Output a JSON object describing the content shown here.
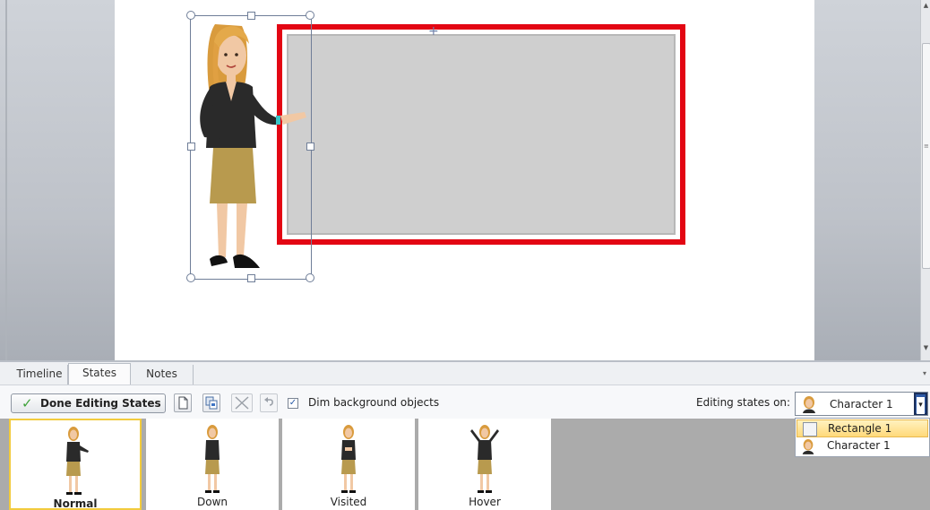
{
  "panel_tabs": [
    "Timeline",
    "States",
    "Notes"
  ],
  "toolbar": {
    "done_label": "Done Editing States",
    "dim_label": "Dim background objects",
    "dim_checked": true,
    "editing_on_label": "Editing states on:",
    "editing_on_value": "Character 1"
  },
  "dropdown": {
    "options": [
      "Rectangle 1",
      "Character 1"
    ],
    "highlighted": "Rectangle 1"
  },
  "states": [
    {
      "label": "Normal",
      "active": true
    },
    {
      "label": "Down",
      "active": false
    },
    {
      "label": "Visited",
      "active": false
    },
    {
      "label": "Hover",
      "active": false
    }
  ],
  "colors": {
    "rectangle_border": "#e30613",
    "rectangle_fill": "#cfcfcf",
    "active_state_border": "#f2cb3d",
    "dropdown_button": "#2d5aa7"
  }
}
